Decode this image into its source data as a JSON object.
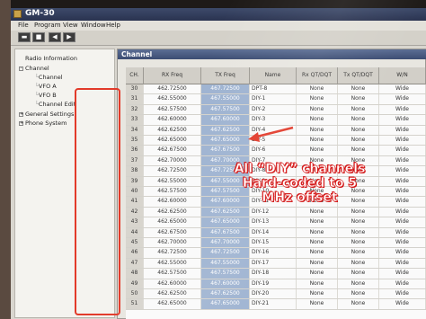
{
  "window": {
    "title": "GM-30"
  },
  "menu": [
    "File",
    "Program",
    "View",
    "Window",
    "Help"
  ],
  "tree": {
    "items": [
      {
        "label": "Radio Information",
        "depth": 0,
        "toggle": ""
      },
      {
        "label": "Channel",
        "depth": 0,
        "toggle": "-"
      },
      {
        "label": "Channel",
        "depth": 1,
        "toggle": ""
      },
      {
        "label": "VFO A",
        "depth": 1,
        "toggle": ""
      },
      {
        "label": "VFO B",
        "depth": 1,
        "toggle": ""
      },
      {
        "label": "Channel Edit",
        "depth": 1,
        "toggle": ""
      },
      {
        "label": "General Settings",
        "depth": 0,
        "toggle": "+"
      },
      {
        "label": "Phone System",
        "depth": 0,
        "toggle": "+"
      }
    ]
  },
  "panel": {
    "title": "Channel"
  },
  "table": {
    "columns": [
      "CH.",
      "RX Freq",
      "TX Freq",
      "Name",
      "Rx QT/DQT",
      "Tx QT/DQT",
      "W/N"
    ],
    "rows": [
      [
        "30",
        "462.72500",
        "467.72500",
        "DPT-8",
        "None",
        "None",
        "Wide"
      ],
      [
        "31",
        "462.55000",
        "467.55000",
        "DIY-1",
        "None",
        "None",
        "Wide"
      ],
      [
        "32",
        "462.57500",
        "467.57500",
        "DIY-2",
        "None",
        "None",
        "Wide"
      ],
      [
        "33",
        "462.60000",
        "467.60000",
        "DIY-3",
        "None",
        "None",
        "Wide"
      ],
      [
        "34",
        "462.62500",
        "467.62500",
        "DIY-4",
        "None",
        "None",
        "Wide"
      ],
      [
        "35",
        "462.65000",
        "467.65000",
        "DIY-5",
        "None",
        "None",
        "Wide"
      ],
      [
        "36",
        "462.67500",
        "467.67500",
        "DIY-6",
        "None",
        "None",
        "Wide"
      ],
      [
        "37",
        "462.70000",
        "467.70000",
        "DIY-7",
        "None",
        "None",
        "Wide"
      ],
      [
        "38",
        "462.72500",
        "467.72500",
        "DIY-8",
        "None",
        "None",
        "Wide"
      ],
      [
        "39",
        "462.55000",
        "467.55000",
        "DIY-9",
        "None",
        "None",
        "Wide"
      ],
      [
        "40",
        "462.57500",
        "467.57500",
        "DIY-10",
        "None",
        "None",
        "Wide"
      ],
      [
        "41",
        "462.60000",
        "467.60000",
        "DIY-11",
        "None",
        "None",
        "Wide"
      ],
      [
        "42",
        "462.62500",
        "467.62500",
        "DIY-12",
        "None",
        "None",
        "Wide"
      ],
      [
        "43",
        "462.65000",
        "467.65000",
        "DIY-13",
        "None",
        "None",
        "Wide"
      ],
      [
        "44",
        "462.67500",
        "467.67500",
        "DIY-14",
        "None",
        "None",
        "Wide"
      ],
      [
        "45",
        "462.70000",
        "467.70000",
        "DIY-15",
        "None",
        "None",
        "Wide"
      ],
      [
        "46",
        "462.72500",
        "467.72500",
        "DIY-16",
        "None",
        "None",
        "Wide"
      ],
      [
        "47",
        "462.55000",
        "467.55000",
        "DIY-17",
        "None",
        "None",
        "Wide"
      ],
      [
        "48",
        "462.57500",
        "467.57500",
        "DIY-18",
        "None",
        "None",
        "Wide"
      ],
      [
        "49",
        "462.60000",
        "467.60000",
        "DIY-19",
        "None",
        "None",
        "Wide"
      ],
      [
        "50",
        "462.62500",
        "467.62500",
        "DIY-20",
        "None",
        "None",
        "Wide"
      ],
      [
        "51",
        "462.65000",
        "467.65000",
        "DIY-21",
        "None",
        "None",
        "Wide"
      ]
    ]
  },
  "annotation": {
    "text": "All “DIY” channels Hard-coded to 5 MHz offset",
    "color": "#e23a2a"
  }
}
